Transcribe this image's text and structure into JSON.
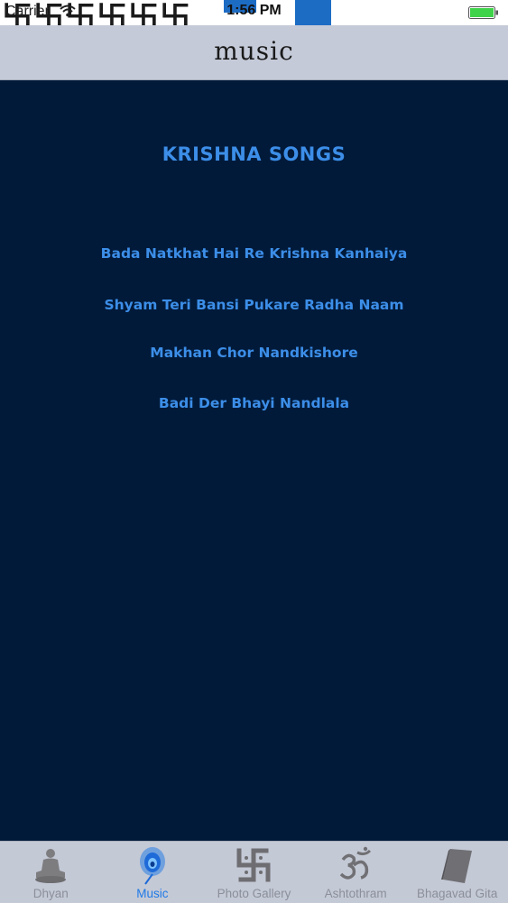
{
  "status_bar": {
    "carrier": "Carrier",
    "time": "1:56 PM",
    "battery_color": "#3fd34a"
  },
  "banner": {
    "symbol": "卐",
    "accent_color": "#1d6cc4"
  },
  "nav": {
    "title": "music"
  },
  "main": {
    "title": "KRISHNA SONGS",
    "songs": [
      {
        "title": "Bada Natkhat Hai Re Krishna Kanhaiya"
      },
      {
        "title": "Shyam Teri Bansi Pukare Radha Naam"
      },
      {
        "title": "Makhan Chor Nandkishore"
      },
      {
        "title": "Badi Der Bhayi Nandlala"
      }
    ],
    "text_color": "#3c8ee8",
    "background": "#011a3a"
  },
  "tabs": [
    {
      "label": "Dhyan",
      "icon": "meditation-icon",
      "active": false
    },
    {
      "label": "Music",
      "icon": "peacock-feather-icon",
      "active": true
    },
    {
      "label": "Photo Gallery",
      "icon": "swastika-icon",
      "active": false
    },
    {
      "label": "Ashtothram",
      "icon": "om-icon",
      "active": false
    },
    {
      "label": "Bhagavad Gita",
      "icon": "book-icon",
      "active": false
    }
  ]
}
